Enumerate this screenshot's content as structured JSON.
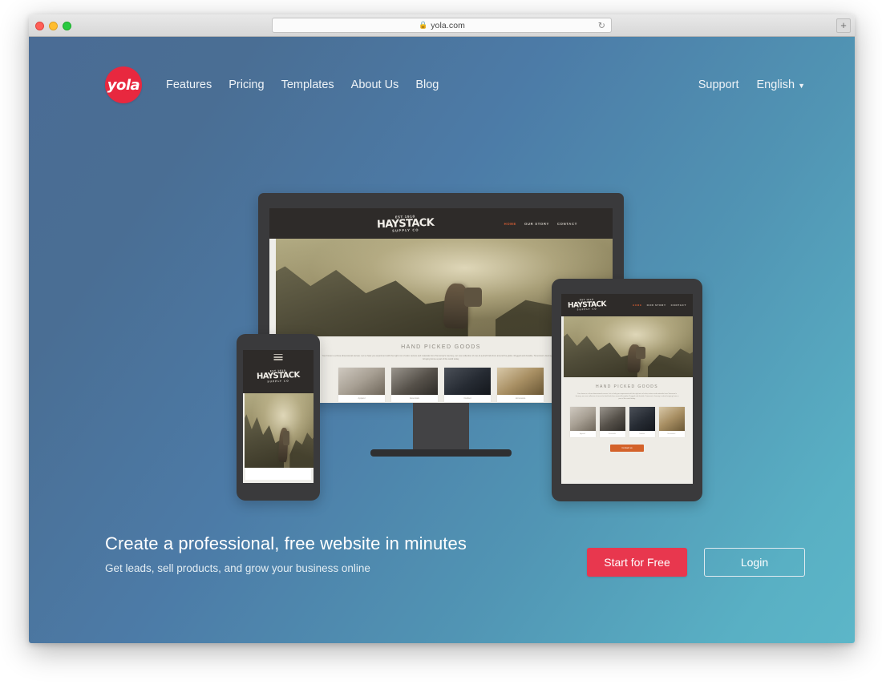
{
  "browser": {
    "url": "yola.com",
    "lock_icon": "lock-icon",
    "reload_icon": "reload-icon",
    "new_tab_label": "+",
    "traffic_lights": [
      "close",
      "minimize",
      "maximize"
    ]
  },
  "nav": {
    "logo_text": "yola",
    "logo_color": "#e8283f",
    "links": [
      {
        "label": "Features"
      },
      {
        "label": "Pricing"
      },
      {
        "label": "Templates"
      },
      {
        "label": "About Us"
      },
      {
        "label": "Blog"
      }
    ],
    "right": {
      "support_label": "Support",
      "language_label": "English",
      "caret_icon": "chevron-down-icon"
    }
  },
  "hero": {
    "title": "Create a professional, free website in minutes",
    "subtitle": "Get leads, sell products, and grow your business online",
    "primary_button": "Start for Free",
    "secondary_button": "Login",
    "primary_color": "#e8374e"
  },
  "mockup_site": {
    "logo": {
      "top": "EST 1910",
      "main": "HAYSTACK",
      "bottom": "SUPPLY CO"
    },
    "nav": [
      {
        "label": "HOME",
        "active": true
      },
      {
        "label": "OUR STORY",
        "active": false
      },
      {
        "label": "CONTACT",
        "active": false
      }
    ],
    "section_heading": "HAND PICKED GOODS",
    "section_body": "Your home is a three dimensional canvas. Let us help you experiment with the right mix of color, texture and materials from Tomorrow's Journey, our new collection of one-of-a-kind finds from around the globe. Rugged and durable, Tomorrow's Journey is about bringing home a part of the world today.",
    "cards": [
      {
        "caption": "Apparel"
      },
      {
        "caption": "Essentials"
      },
      {
        "caption": "Outdoor"
      },
      {
        "caption": "Homeware"
      }
    ],
    "cta_button": "Contact us",
    "cta_color": "#d4622a"
  },
  "background": {
    "top_left": "#4a6c95",
    "top_right": "#4d6b98",
    "bottom_left": "#4e87ad",
    "bottom_right": "#5cb6c8"
  }
}
